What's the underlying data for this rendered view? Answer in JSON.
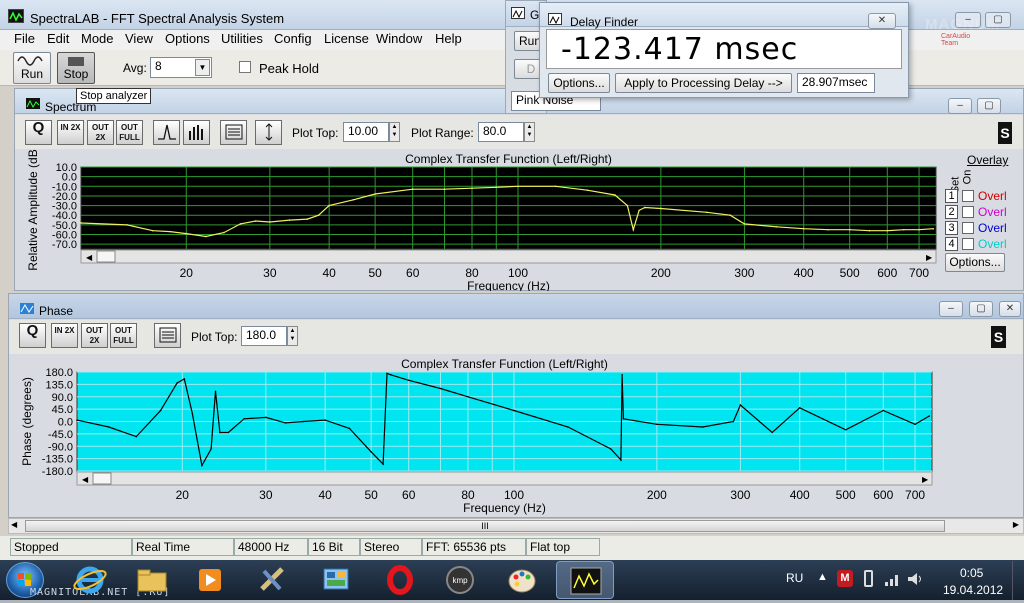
{
  "app": {
    "title": "SpectraLAB - FFT Spectral Analysis System"
  },
  "menu": [
    "File",
    "Edit",
    "Mode",
    "View",
    "Options",
    "Utilities",
    "Config",
    "License",
    "Window",
    "Help"
  ],
  "toolbar": {
    "run_label": "Run",
    "stop_label": "Stop",
    "avg_label": "Avg:",
    "avg_value": "8",
    "peak_hold_label": "Peak Hold",
    "tooltip": "Stop analyzer"
  },
  "background_window": {
    "title": "Ge",
    "run_label": "Run",
    "d_label": "D",
    "pink_noise": "Pink Noise"
  },
  "delay_finder": {
    "title": "Delay Finder",
    "value": "-123.417 msec",
    "options_label": "Options...",
    "apply_label": "Apply to Processing Delay -->",
    "delay_value": "28.907msec"
  },
  "watermark": {
    "text": "MAGNUM",
    "sub": "CarAudio Team"
  },
  "spectrum": {
    "window_title": "Spectrum",
    "icons": {
      "zoom": "Q",
      "in2x": "IN 2X",
      "out2x": "OUT 2X",
      "outfull": "OUT FULL"
    },
    "plot_top_label": "Plot Top:",
    "plot_top_value": "10.00",
    "plot_range_label": "Plot Range:",
    "plot_range_value": "80.0",
    "overlay_label": "Overlay",
    "set_label": "Set",
    "on_label": "On",
    "overlays": [
      {
        "n": "1",
        "label": "Overl",
        "color": "#cc0000"
      },
      {
        "n": "2",
        "label": "Overl",
        "color": "#cc00cc"
      },
      {
        "n": "3",
        "label": "Overl",
        "color": "#0000cc"
      },
      {
        "n": "4",
        "label": "Overl",
        "color": "#00cccc"
      }
    ],
    "options_label": "Options...",
    "s_badge": "S"
  },
  "phase": {
    "window_title": "Phase",
    "plot_top_label": "Plot Top:",
    "plot_top_value": "180.0",
    "s_badge": "S",
    "hscroll_mark": "III"
  },
  "chart_data": [
    {
      "type": "line",
      "title": "Complex Transfer Function (Left/Right)",
      "xlabel": "Frequency (Hz)",
      "ylabel": "Relative Amplitude (dB)",
      "xscale": "log",
      "xlim": [
        12,
        760
      ],
      "ylim": [
        -75,
        10
      ],
      "xticks": [
        "20",
        "30",
        "40",
        "50",
        "60",
        "80",
        "100",
        "200",
        "300",
        "400",
        "500",
        "600",
        "700"
      ],
      "yticks": [
        "10.0",
        "0.0",
        "-10.0",
        "-20.0",
        "-30.0",
        "-40.0",
        "-50.0",
        "-60.0",
        "-70.0"
      ],
      "grid": true,
      "background": "#000000",
      "line_color": "#f0f060",
      "x": [
        12,
        15,
        17,
        18.5,
        20,
        22,
        24,
        26,
        28,
        30,
        33,
        36,
        38,
        40,
        45,
        50,
        60,
        70,
        80,
        90,
        100,
        120,
        140,
        160,
        170,
        175,
        180,
        185,
        200,
        250,
        280,
        300,
        350,
        400,
        450,
        500,
        550,
        600,
        650,
        700,
        750
      ],
      "y": [
        -48,
        -50,
        -56,
        -57,
        -59,
        -62,
        -58,
        -49,
        -46,
        -47,
        -45,
        -44,
        -40,
        -30,
        -24,
        -18,
        -13,
        -13,
        -12,
        -11,
        -10,
        -10,
        -14,
        -19,
        -30,
        -55,
        -35,
        -32,
        -33,
        -37,
        -40,
        -49,
        -52,
        -54,
        -55,
        -55,
        -56,
        -56,
        -55,
        -55,
        -54
      ]
    },
    {
      "type": "line",
      "title": "Complex Transfer Function (Left/Right)",
      "xlabel": "Frequency (Hz)",
      "ylabel": "Phase (degrees)",
      "xscale": "log",
      "xlim": [
        12,
        760
      ],
      "ylim": [
        -180,
        180
      ],
      "xticks": [
        "20",
        "30",
        "40",
        "50",
        "60",
        "80",
        "100",
        "200",
        "300",
        "400",
        "500",
        "600",
        "700"
      ],
      "yticks": [
        "180.0",
        "135.0",
        "90.0",
        "45.0",
        "0.0",
        "-45.0",
        "-90.0",
        "-135.0",
        "-180.0"
      ],
      "grid": true,
      "background": "#00e5ef",
      "line_color": "#000000",
      "x": [
        12,
        14,
        16,
        18,
        19.5,
        20.2,
        21,
        22,
        23,
        23.5,
        24,
        25,
        27,
        30,
        33,
        36,
        40,
        45,
        50,
        53,
        54,
        55,
        60,
        70,
        80,
        100,
        130,
        160,
        168,
        169,
        170,
        200,
        250,
        290,
        300,
        350,
        400,
        500,
        600,
        700,
        750
      ],
      "y": [
        5,
        -20,
        -55,
        40,
        140,
        155,
        30,
        -160,
        -100,
        110,
        -40,
        -40,
        10,
        15,
        -5,
        0,
        5,
        -25,
        -110,
        -155,
        175,
        170,
        150,
        120,
        90,
        40,
        -20,
        -100,
        -140,
        170,
        10,
        -10,
        -20,
        0,
        60,
        -40,
        50,
        -30,
        40,
        -10,
        20
      ]
    }
  ],
  "statusbar": [
    "Stopped",
    "Real Time",
    "48000 Hz",
    "16 Bit",
    "Stereo",
    "FFT: 65536 pts",
    "Flat top"
  ],
  "taskbar": {
    "watermark": "MAGNITOLAB.NET [.RU]",
    "lang": "RU",
    "time": "0:05",
    "date": "19.04.2012",
    "tray_badge": "M"
  },
  "colors": {
    "desktop": "#aeb4bb",
    "taskbar": "#1a2a3c",
    "accent": "#2d6fd1"
  }
}
